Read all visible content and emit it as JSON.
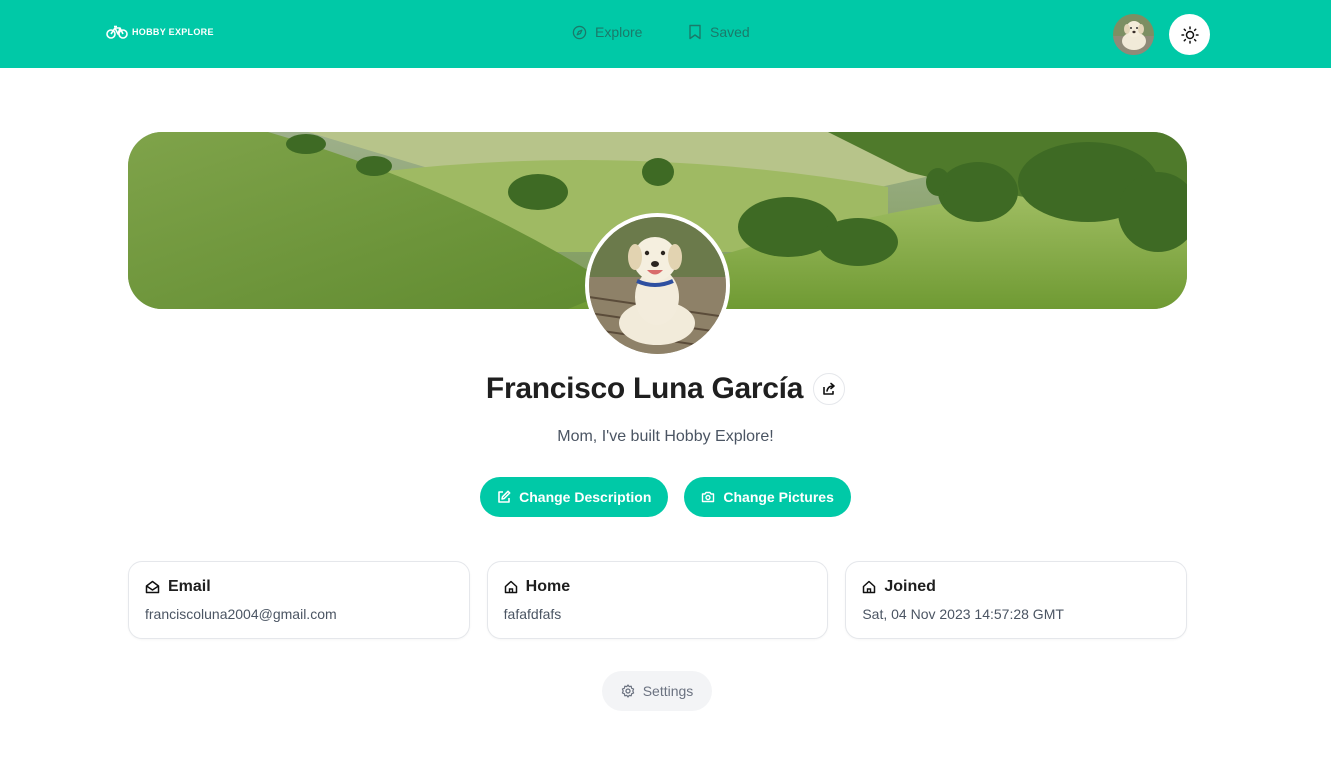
{
  "header": {
    "logo_text": "HOBBY EXPLORE",
    "nav": [
      {
        "label": "Explore",
        "icon": "compass-icon"
      },
      {
        "label": "Saved",
        "icon": "bookmark-icon"
      }
    ],
    "avatar_icon": "user-avatar",
    "theme_icon": "sun-icon"
  },
  "profile": {
    "name": "Francisco Luna García",
    "description": "Mom, I've built Hobby Explore!",
    "share_icon": "share-icon"
  },
  "actions": {
    "change_description": "Change Description",
    "change_pictures": "Change Pictures"
  },
  "info_cards": [
    {
      "title": "Email",
      "value": "franciscoluna2004@gmail.com",
      "icon": "mail-open-icon"
    },
    {
      "title": "Home",
      "value": "fafafdfafs",
      "icon": "home-icon"
    },
    {
      "title": "Joined",
      "value": "Sat, 04 Nov 2023 14:57:28 GMT",
      "icon": "home-icon"
    }
  ],
  "settings": {
    "label": "Settings",
    "icon": "gear-icon"
  },
  "colors": {
    "accent": "#00c9a7",
    "accent_text": "#1a7a6a",
    "muted": "#4b5563"
  }
}
